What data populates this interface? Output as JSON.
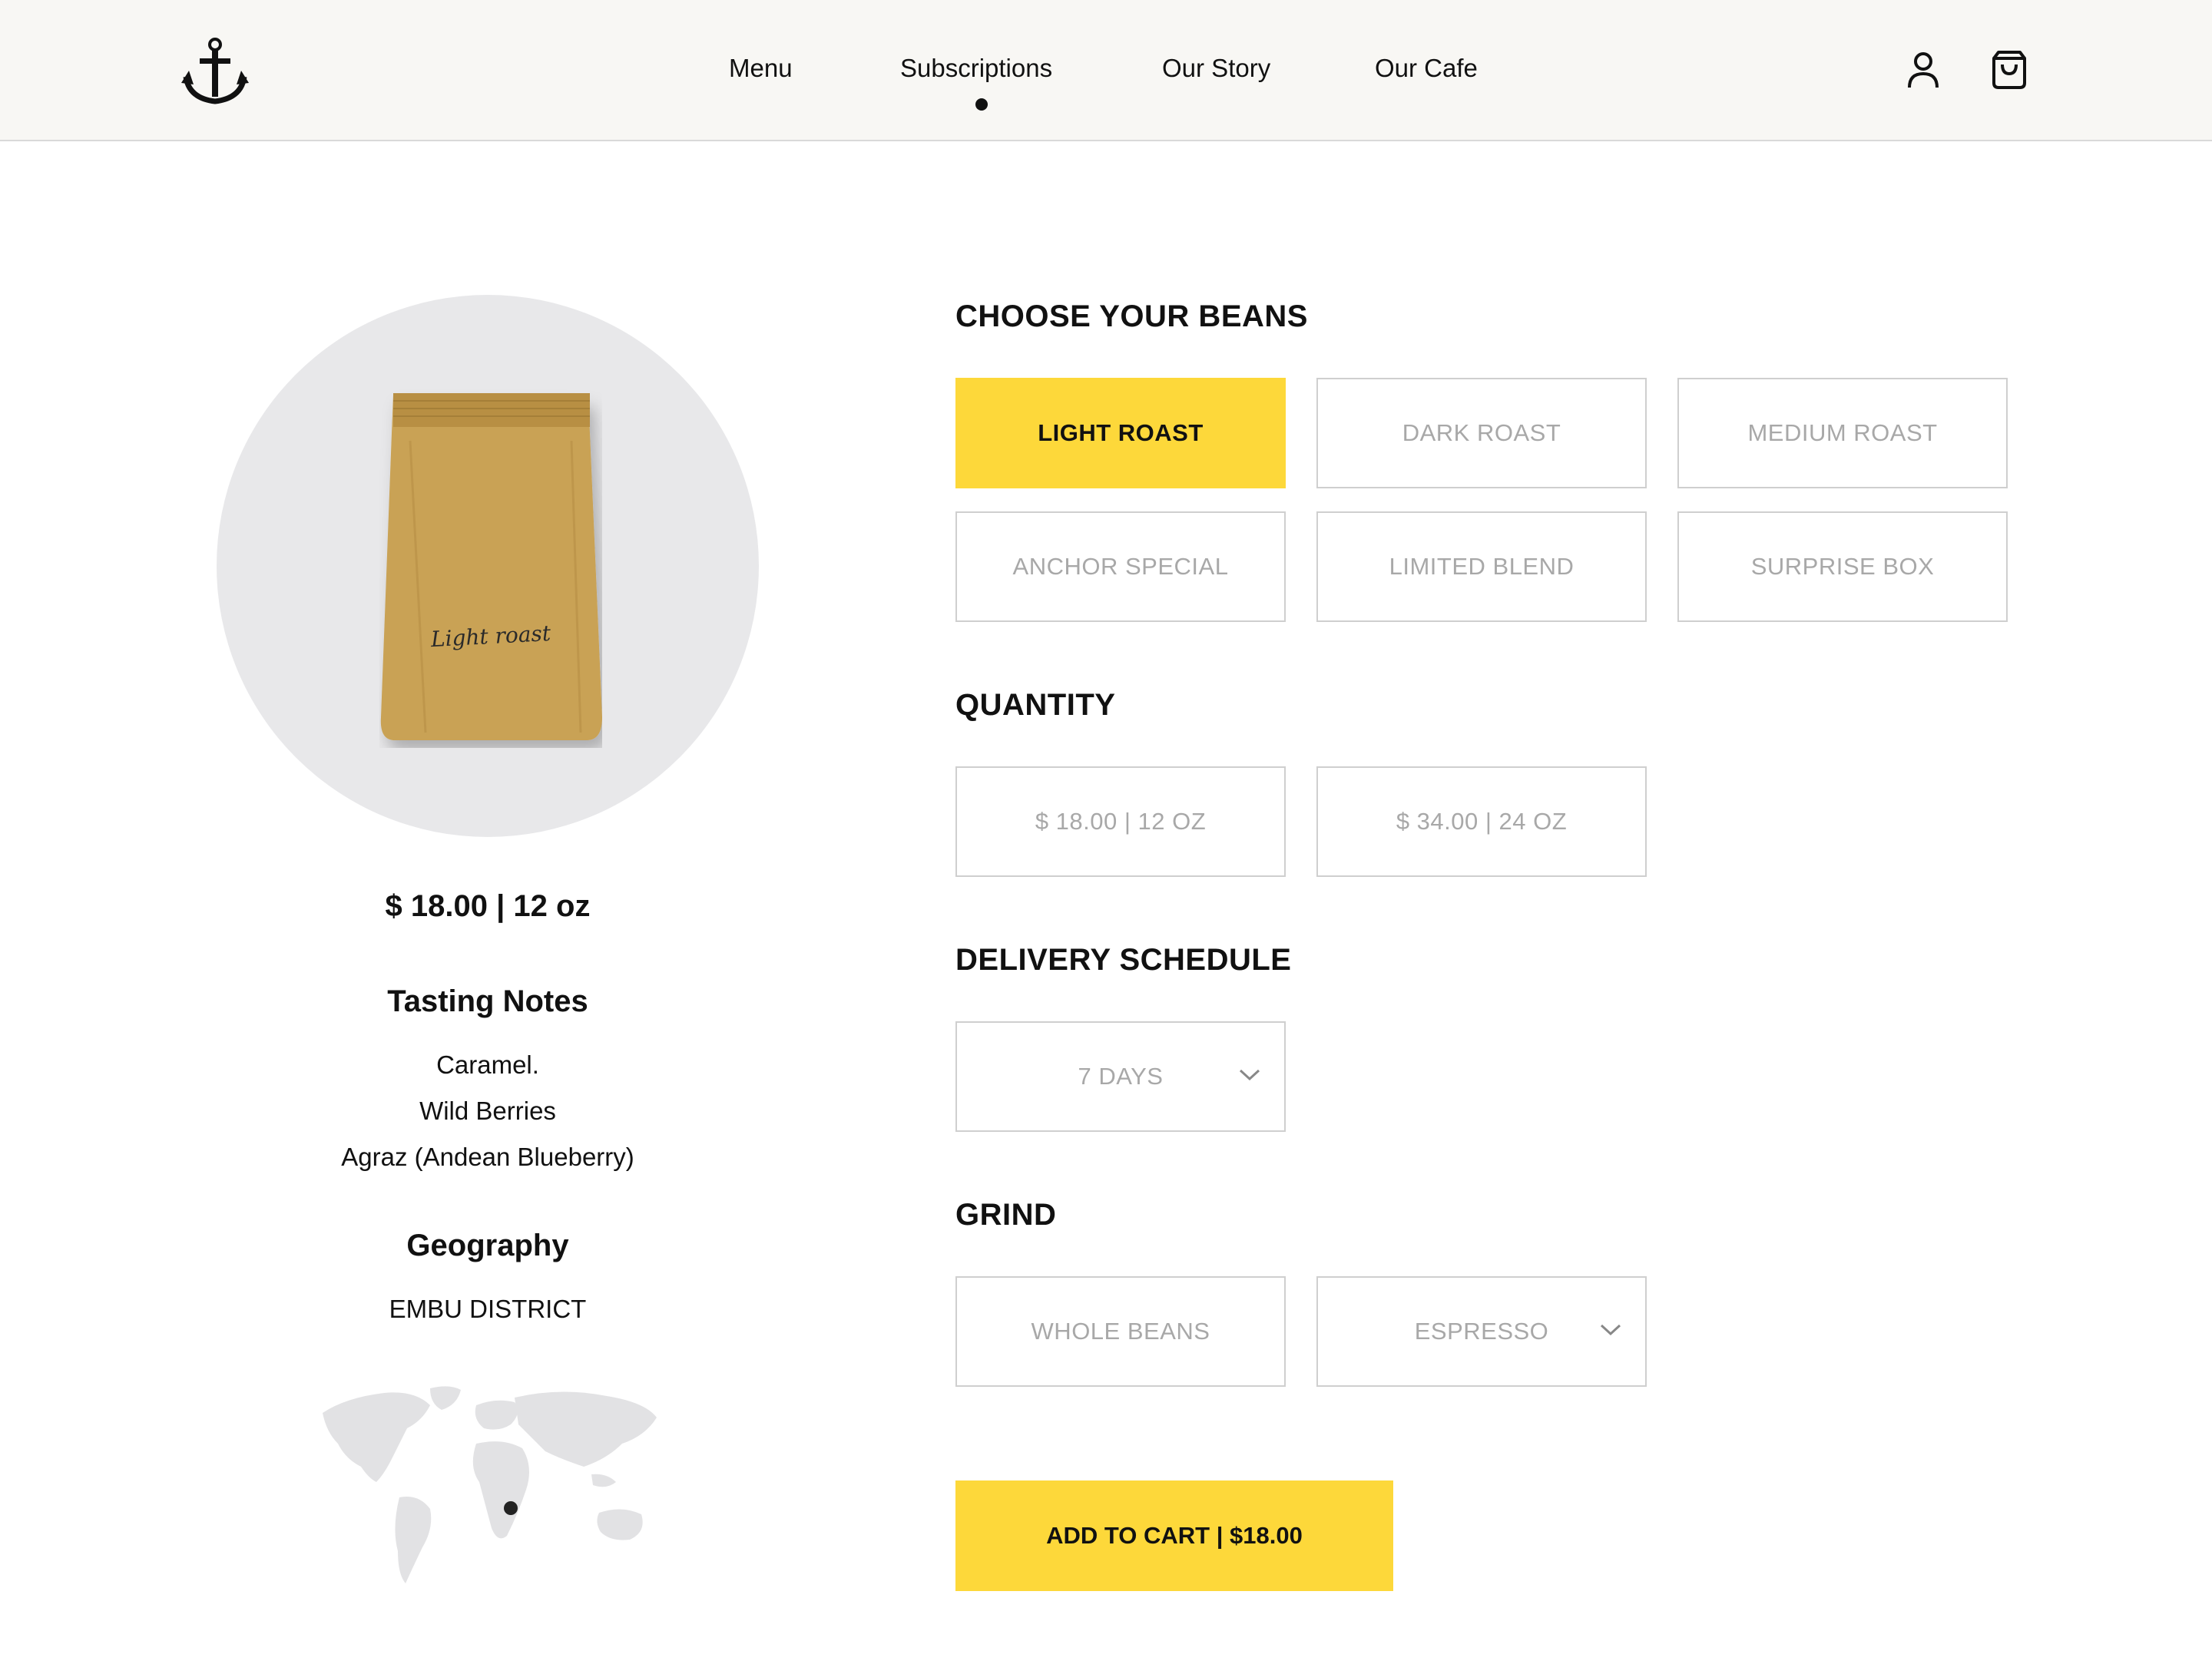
{
  "nav": {
    "items": [
      {
        "label": "Menu"
      },
      {
        "label": "Subscriptions",
        "active": true
      },
      {
        "label": "Our Story"
      },
      {
        "label": "Our Cafe"
      }
    ],
    "logo_icon": "anchor-icon",
    "account_icon": "user-icon",
    "cart_icon": "shopping-bag-icon"
  },
  "product": {
    "bag_label": "Light roast",
    "price_line": "$ 18.00 | 12 oz",
    "tasting_heading": "Tasting Notes",
    "tasting_notes": [
      "Caramel.",
      "Wild Berries",
      "Agraz (Andean Blueberry)"
    ],
    "geography_heading": "Geography",
    "geography_value": "EMBU DISTRICT"
  },
  "beans": {
    "title": "CHOOSE YOUR BEANS",
    "options": [
      "LIGHT ROAST",
      "DARK ROAST",
      "MEDIUM ROAST",
      "ANCHOR SPECIAL",
      "LIMITED BLEND",
      "SURPRISE BOX"
    ],
    "selected": "LIGHT ROAST"
  },
  "quantity": {
    "title": "QUANTITY",
    "options": [
      "$ 18.00 | 12 OZ",
      "$ 34.00 | 24 OZ"
    ]
  },
  "delivery": {
    "title": "DELIVERY SCHEDULE",
    "value": "7 DAYS"
  },
  "grind": {
    "title": "GRIND",
    "options": [
      "WHOLE BEANS",
      "ESPRESSO"
    ]
  },
  "cart": {
    "label": "ADD TO CART | $18.00"
  },
  "colors": {
    "accent": "#fdd83a",
    "header_bg": "#f8f7f4",
    "bag": "#c9a254",
    "circle": "#e8e8ea",
    "muted_text": "#a8a8a8"
  }
}
